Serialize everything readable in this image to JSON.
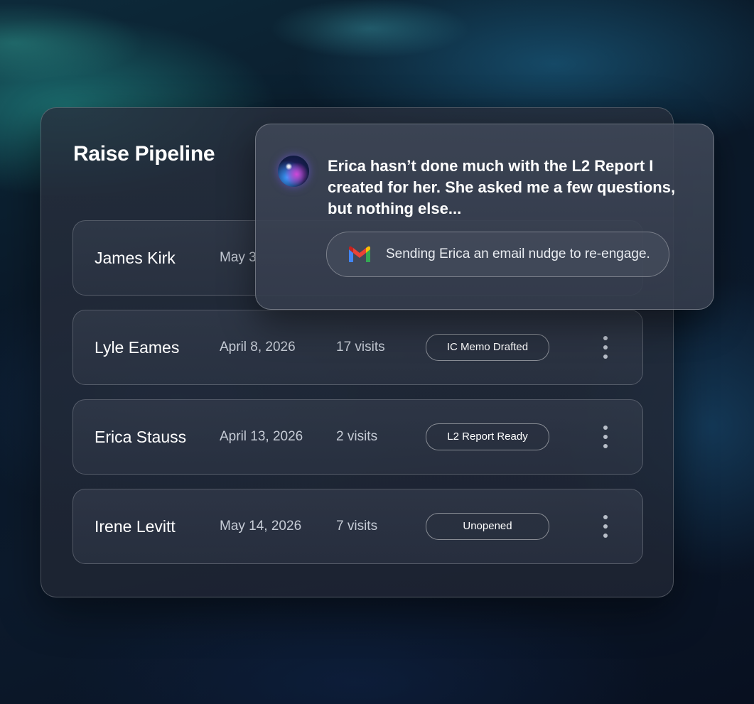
{
  "panel": {
    "title": "Raise Pipeline"
  },
  "rows": [
    {
      "name": "James Kirk",
      "date": "May 3",
      "visits": "",
      "status": ""
    },
    {
      "name": "Lyle Eames",
      "date": "April 8, 2026",
      "visits": "17 visits",
      "status": "IC Memo Drafted"
    },
    {
      "name": "Erica Stauss",
      "date": "April 13, 2026",
      "visits": "2 visits",
      "status": "L2 Report Ready"
    },
    {
      "name": "Irene Levitt",
      "date": "May 14, 2026",
      "visits": "7 visits",
      "status": "Unopened"
    }
  ],
  "assistant": {
    "message": "Erica hasn’t done much with the L2 Report I created for her. She asked me a few questions, but nothing else...",
    "action": {
      "icon": "gmail-icon",
      "text": "Sending Erica an email nudge to re-engage."
    }
  },
  "colors": {
    "panel": "#262e3c",
    "text": "#ffffff",
    "muted": "#c6ccd6"
  }
}
